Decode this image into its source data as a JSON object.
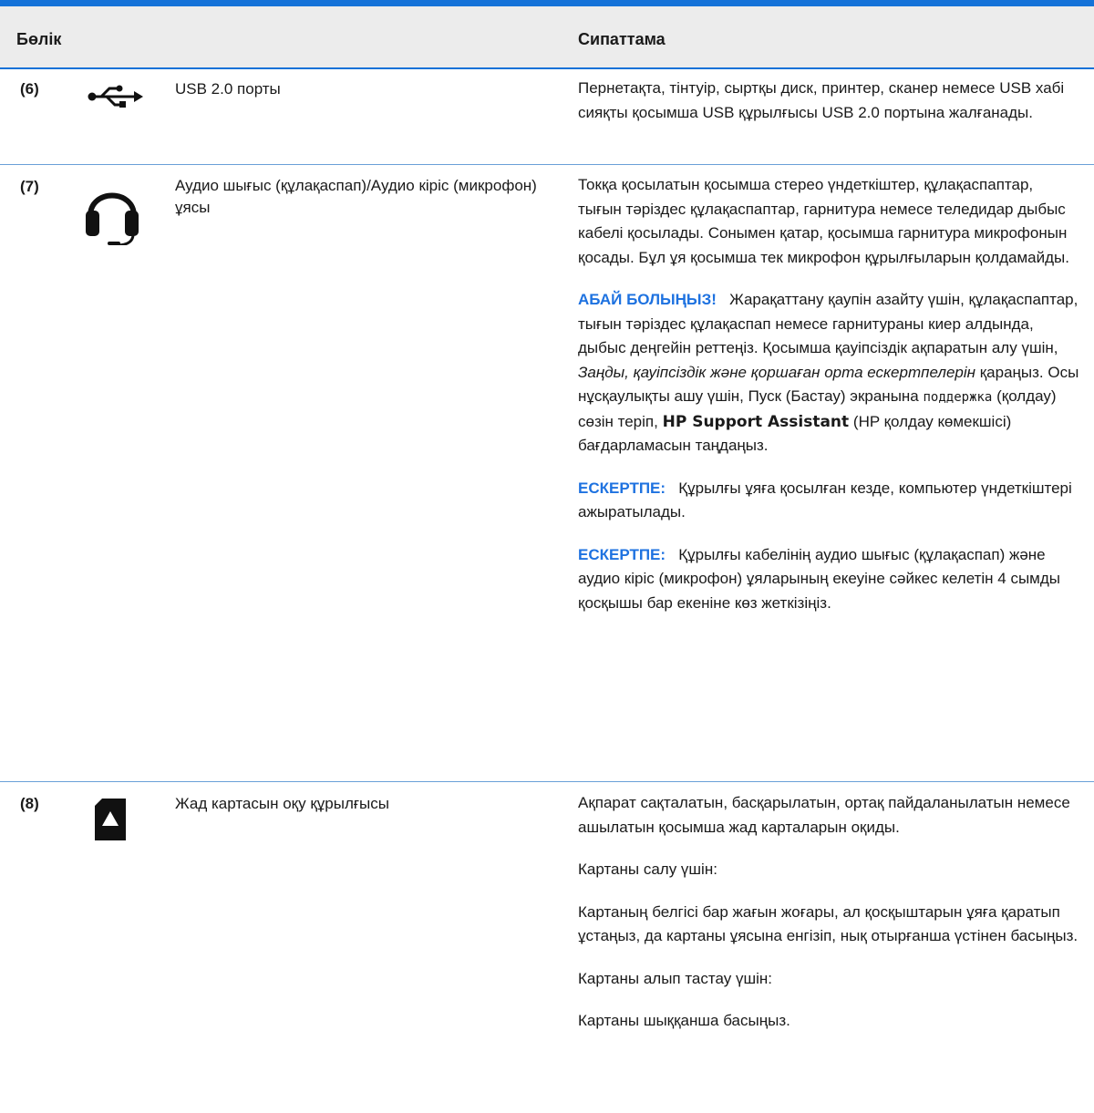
{
  "colors": {
    "accent": "#1472d8",
    "note_label": "#1e72e0",
    "header_bg": "#ececec"
  },
  "header": {
    "col_part": "Бөлік",
    "col_description": "Сипаттама"
  },
  "rows": [
    {
      "number": "(6)",
      "icon": "usb-icon",
      "name": "USB 2.0 порты",
      "description": "Пернетақта, тінтуір, сыртқы диск, принтер, сканер немесе USB хабі сияқты қосымша USB құрылғысы USB 2.0 портына жалғанады."
    },
    {
      "number": "(7)",
      "icon": "headset-icon",
      "name": "Аудио шығыс (құлақаспап)/Аудио кіріс (микрофон) ұясы",
      "description": "Токқа қосылатын қосымша стерео үндеткіштер, құлақаспаптар, тығын тәріздес құлақаспаптар, гарнитура немесе теледидар дыбыс кабелі қосылады. Сонымен қатар, қосымша гарнитура микрофонын қосады. Бұл ұя қосымша тек микрофон құрылғыларын қолдамайды.",
      "warning": {
        "label": "АБАЙ БОЛЫҢЫЗ!",
        "text_1": "Жарақаттану қаупін азайту үшін, құлақаспаптар, тығын тәріздес құлақаспап немесе гарнитураны киер алдында, дыбыс деңгейін реттеңіз. Қосымша қауіпсіздік ақпаратын алу үшін,",
        "italic_ref": "Заңды, қауіпсіздік және қоршаған орта ескертпелерін",
        "text_2": "қараңыз. Осы нұсқаулықты ашу үшін, Пуск (Бастау) экранына",
        "code": "поддержка",
        "text_3": "(қолдау) сөзін теріп,",
        "bold_term": "HP Support Assistant",
        "text_4": "(HP қолдау көмекшісі) бағдарламасын таңдаңыз."
      },
      "note_1": {
        "label": "ЕСКЕРТПЕ:",
        "text": "Құрылғы ұяға қосылған кезде, компьютер үндеткіштері ажыратылады."
      },
      "note_2": {
        "label": "ЕСКЕРТПЕ:",
        "text": "Құрылғы кабелінің аудио шығыс (құлақаспап) және аудио кіріс (микрофон) ұяларының екеуіне сәйкес келетін 4 сымды қосқышы бар екеніне көз жеткізіңіз."
      }
    },
    {
      "number": "(8)",
      "icon": "memory-card-icon",
      "name": "Жад картасын оқу құрылғысы",
      "description": "Ақпарат сақталатын, басқарылатын, ортақ пайдаланылатын немесе ашылатын қосымша жад карталарын оқиды.",
      "insert_heading": "Картаны салу үшін:",
      "insert_text": "Картаның белгісі бар жағын жоғары, ал қосқыштарын ұяға қаратып ұстаңыз, да картаны ұясына енгізіп, нық отырғанша үстінен басыңыз.",
      "remove_heading": "Картаны алып тастау үшін:",
      "remove_text": "Картаны шыққанша басыңыз."
    }
  ]
}
